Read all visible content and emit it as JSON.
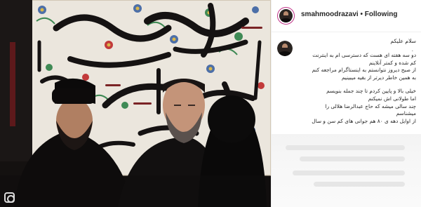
{
  "header": {
    "username": "smahmoodrazavi",
    "separator": "•",
    "follow_status": "Following"
  },
  "caption": {
    "greeting": "سلام علیکم",
    "dot": ".",
    "paragraph1": [
      "دو سه هفته ای هست که دسترسی ام به اینترنت",
      "کم شده و کمتر آنلاینم",
      "از صبح دیروز نتوانستم به اینستاگرام مراجعه کنم",
      "به همین خاطر دیرتر از بقیه میبینیم"
    ],
    "paragraph2": [
      "خیلی بالا و پایین کردم تا چند جمله بنویسم",
      "اما طولانی اش نمیکنم",
      "چند سالی میشه که حاج عبدالرضا هلالی را",
      "میشناسم",
      "از اوایل دهه ی ۸۰ هم جوانی های کم سن و سال"
    ]
  },
  "colors": {
    "avatar_ring": "#c1358a",
    "text": "#262626",
    "divider": "#efefef"
  },
  "icons": {
    "photo_watermark": "instagram-icon"
  }
}
